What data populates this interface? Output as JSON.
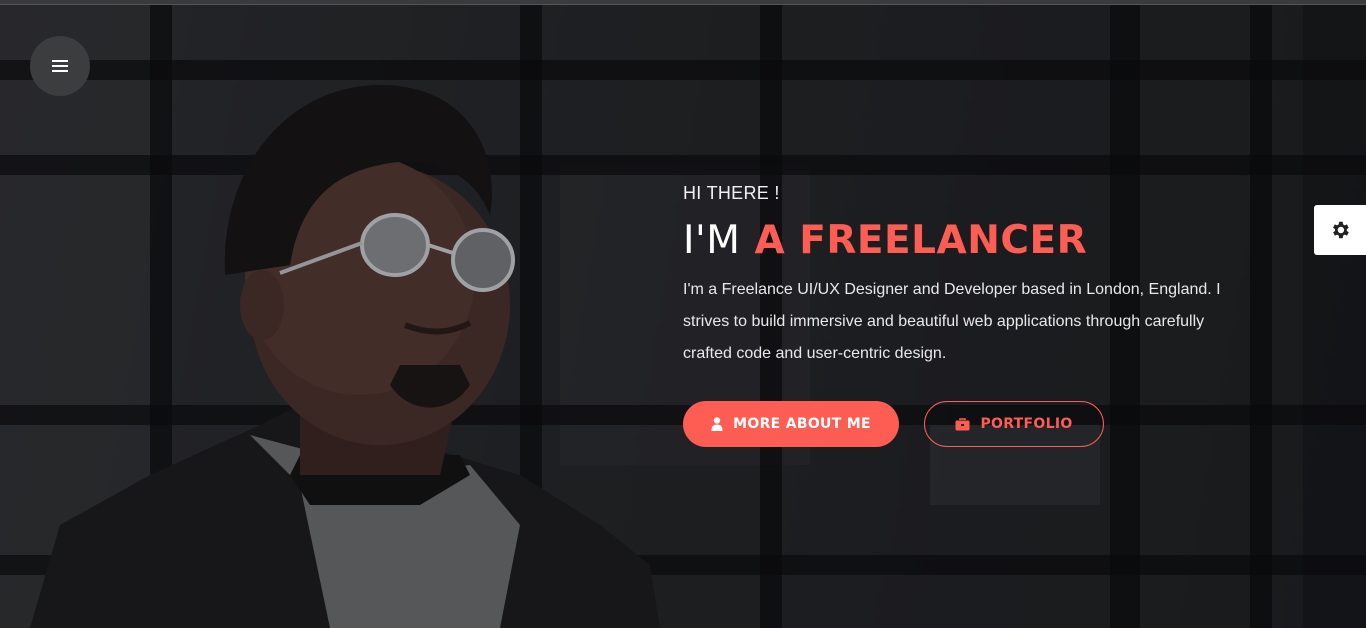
{
  "menu": {
    "icon": "hamburger-menu-icon"
  },
  "settings": {
    "icon": "gear-icon"
  },
  "hero": {
    "greeting": "HI THERE !",
    "headline_prefix": "I'M",
    "headline_accent": "A FREELANCER",
    "description": "I'm a Freelance UI/UX Designer and Developer based in London, England. I strives to build immersive and beautiful web applications through carefully crafted code and user-centric design."
  },
  "buttons": {
    "about_label": "MORE ABOUT ME",
    "about_icon": "user-icon",
    "portfolio_label": "PORTFOLIO",
    "portfolio_icon": "briefcase-icon"
  },
  "colors": {
    "accent": "#fe5d53",
    "background": "#222426",
    "text": "#ffffff"
  }
}
